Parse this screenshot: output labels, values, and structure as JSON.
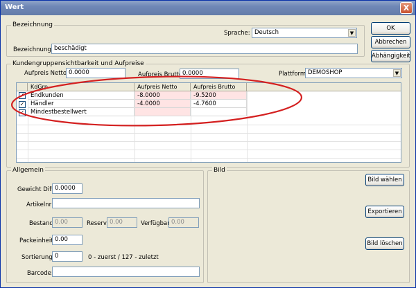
{
  "window": {
    "title": "Wert",
    "close_label": "X"
  },
  "bezeichnung": {
    "group_label": "Bezeichnung",
    "sprache_label": "Sprache:",
    "sprache_value": "Deutsch",
    "bezeichnung_label": "Bezeichnung:",
    "bezeichnung_value": "beschädigt"
  },
  "buttons": {
    "ok": "OK",
    "abbrechen": "Abbrechen",
    "abhaengigkeit": "Abhängigkeit"
  },
  "kunden": {
    "group_label": "Kundengruppensichtbarkeit und Aufpreise",
    "netto_label": "Aufpreis Netto:",
    "netto_value": "0.0000",
    "brutto_label": "Aufpreis Brutto:",
    "brutto_value": "0.0000",
    "plattform_label": "Plattform:",
    "plattform_value": "DEMOSHOP",
    "columns": [
      "KdGrp",
      "Aufpreis Netto",
      "Aufpreis Brutto"
    ],
    "rows": [
      {
        "checked": "✓",
        "name": "Endkunden",
        "netto": "-8.0000",
        "brutto": "-9.5200"
      },
      {
        "checked": "✓",
        "name": "Händler",
        "netto": "-4.0000",
        "brutto": "-4.7600"
      },
      {
        "checked": "✓",
        "name": "Mindestbestellwert",
        "netto": "",
        "brutto": ""
      }
    ]
  },
  "allgemein": {
    "group_label": "Allgemein",
    "gewicht_label": "Gewicht Diff.:",
    "gewicht_value": "0.0000",
    "artikelnr_label": "Artikelnr:",
    "artikelnr_value": "",
    "bestand_label": "Bestand:",
    "bestand_value": "0.00",
    "reserv_label": "Reserv.",
    "reserv_value": "0.00",
    "verfuegbar_label": "Verfügbar:",
    "verfuegbar_value": "0.00",
    "packeinheit_label": "Packeinheit:",
    "packeinheit_value": "0.00",
    "sortierung_label": "Sortierung:",
    "sortierung_value": "0",
    "sortierung_hint": "0 - zuerst / 127 - zuletzt",
    "barcode_label": "Barcode:",
    "barcode_value": ""
  },
  "bild": {
    "group_label": "Bild",
    "waehlen": "Bild wählen",
    "exportieren": "Exportieren",
    "loeschen": "Bild löschen"
  },
  "colors": {
    "annotation": "#d42020",
    "highlight": "#ffe4e4"
  }
}
